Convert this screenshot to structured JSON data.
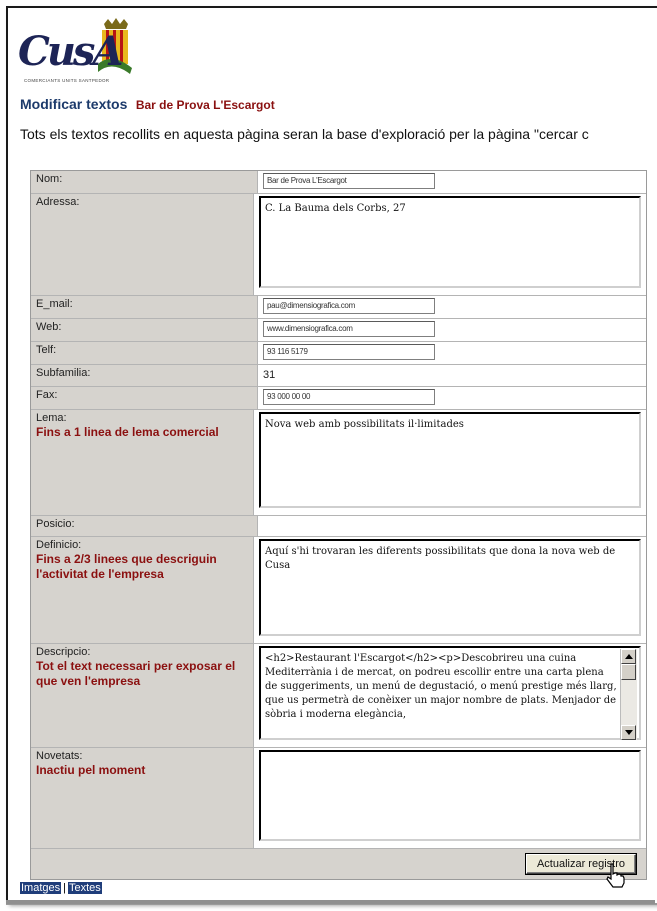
{
  "logo": {
    "word": "CusA",
    "tagline": "COMERCIANTS UNITS SANTPEDOR"
  },
  "header": {
    "title": "Modificar textos",
    "subtitle": "Bar de Prova L'Escargot"
  },
  "intro": "Tots els textos recollits en aquesta pàgina seran la base d'exploració per la pàgina \"cercar c",
  "form": {
    "nom": {
      "label": "Nom:",
      "value": "Bar de Prova L'Escargot"
    },
    "adressa": {
      "label": "Adressa:",
      "value": "C. La Bauma dels Corbs, 27"
    },
    "email": {
      "label": "E_mail:",
      "value": "pau@dimensiografica.com"
    },
    "web": {
      "label": "Web:",
      "value": "www.dimensiografica.com"
    },
    "telf": {
      "label": "Telf:",
      "value": "93 116 5179"
    },
    "subfamilia": {
      "label": "Subfamilia:",
      "value": "31"
    },
    "fax": {
      "label": "Fax:",
      "value": "93 000 00 00"
    },
    "lema": {
      "label": "Lema:",
      "note": "Fins a 1 linea de lema comercial",
      "value": "Nova web amb possibilitats il·limitades"
    },
    "posicio": {
      "label": "Posicio:"
    },
    "definicio": {
      "label": "Definicio:",
      "note": "Fins a 2/3 linees que descriguin l'activitat de l'empresa",
      "value": "Aquí s'hi trovaran les diferents possibilitats que dona la nova web de Cusa"
    },
    "descripcio": {
      "label": "Descripcio:",
      "note": "Tot el text necessari per exposar el que ven l'empresa",
      "value": "<h2>Restaurant l'Escargot</h2><p>Descobrireu una cuina Mediterrània i de mercat, on podreu escollir entre una carta plena de suggeriments, un menú de degustació, o menú prestige més llarg, que us permetrà de conèixer un major nombre de plats. Menjador de sòbria i moderna elegància,"
    },
    "novetats": {
      "label": "Novetats:",
      "note": "Inactiu pel moment",
      "value": ""
    },
    "submit_label": "Actualizar registro"
  },
  "links": {
    "imatges": "Imatges",
    "separator": "|",
    "textes": "Textes"
  }
}
